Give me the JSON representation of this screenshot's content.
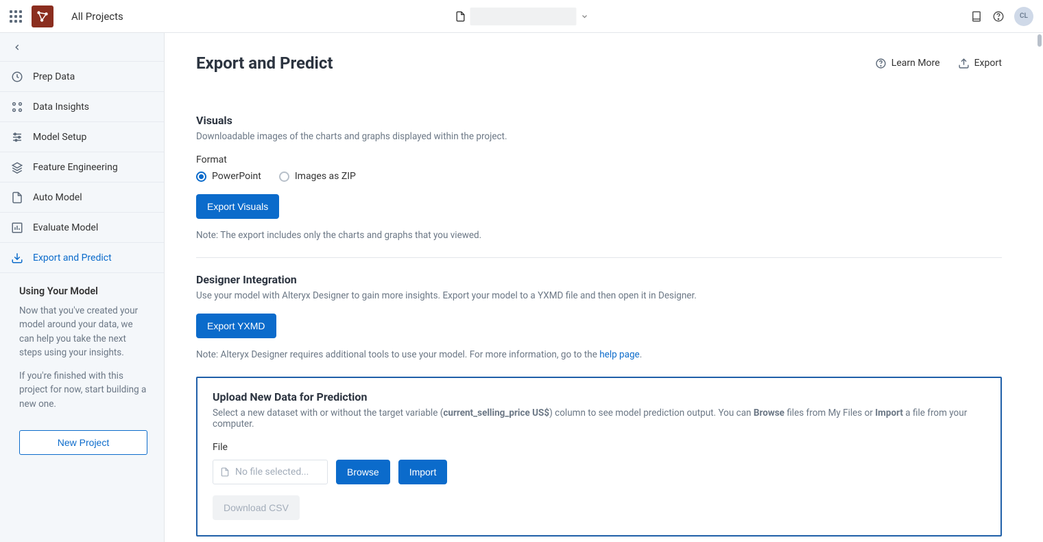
{
  "topbar": {
    "breadcrumb": "All Projects",
    "avatar_initials": "CL"
  },
  "sidebar": {
    "items": [
      {
        "label": "Prep Data"
      },
      {
        "label": "Data Insights"
      },
      {
        "label": "Model Setup"
      },
      {
        "label": "Feature Engineering"
      },
      {
        "label": "Auto Model"
      },
      {
        "label": "Evaluate Model"
      },
      {
        "label": "Export and Predict"
      }
    ],
    "desc_title": "Using Your Model",
    "desc_p1": "Now that you've created your model around your data, we can help you take the next steps using your insights.",
    "desc_p2": "If you're finished with this project for now, start building a new one.",
    "new_project_btn": "New Project"
  },
  "page": {
    "title": "Export and Predict",
    "learn_more": "Learn More",
    "export": "Export"
  },
  "visuals": {
    "heading": "Visuals",
    "sub": "Downloadable images of the charts and graphs displayed within the project.",
    "format_label": "Format",
    "radio_ppt": "PowerPoint",
    "radio_zip": "Images as ZIP",
    "btn": "Export Visuals",
    "note": "Note: The export includes only the charts and graphs that you viewed."
  },
  "designer": {
    "heading": "Designer Integration",
    "sub": "Use your model with Alteryx Designer to gain more insights. Export your model to a YXMD file and then open it in Designer.",
    "btn": "Export YXMD",
    "note_prefix": "Note: Alteryx Designer requires additional tools to use your model. For more information, go to the ",
    "note_link": "help page",
    "note_suffix": "."
  },
  "upload": {
    "heading": "Upload New Data for Prediction",
    "sub_prefix": "Select a new dataset with or without the target variable (",
    "sub_bold": "current_selling_price US$",
    "sub_mid": ") column to see model prediction output. You can ",
    "sub_browse": "Browse",
    "sub_mid2": " files from My Files or ",
    "sub_import": "Import",
    "sub_suffix": " a file from your computer.",
    "file_label": "File",
    "file_placeholder": "No file selected...",
    "browse_btn": "Browse",
    "import_btn": "Import",
    "download_btn": "Download CSV"
  }
}
